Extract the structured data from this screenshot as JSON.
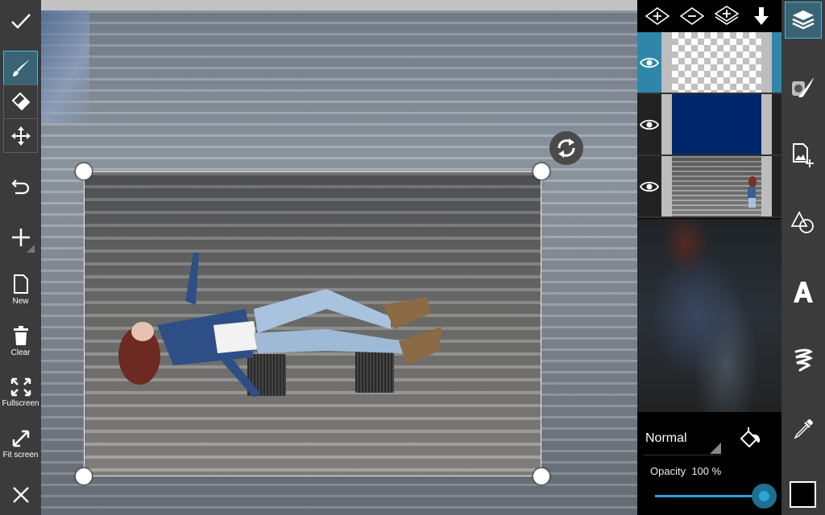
{
  "left_toolbar": {
    "confirm": "check-icon",
    "tools": [
      {
        "name": "brush",
        "active": true
      },
      {
        "name": "eraser",
        "active": false
      },
      {
        "name": "move",
        "active": false
      }
    ],
    "undo": "undo-icon",
    "add": "plus-icon",
    "new_label": "New",
    "clear_label": "Clear",
    "fullscreen_label": "Fullscreen",
    "fit_screen_label": "Fit screen",
    "close": "close-icon"
  },
  "layers": {
    "toolbar": [
      "add-layer",
      "remove-layer",
      "duplicate-layer",
      "merge-down"
    ],
    "items": [
      {
        "type": "transparent",
        "visible": true,
        "selected": true
      },
      {
        "type": "fill",
        "color": "#00276b",
        "visible": true,
        "selected": false
      },
      {
        "type": "photo",
        "visible": true,
        "selected": false
      }
    ]
  },
  "blend": {
    "mode": "Normal",
    "opacity_label": "Opacity",
    "opacity_value": "100 %",
    "opacity": 1.0
  },
  "right_toolbar": {
    "tools": [
      "layers",
      "photo-brush",
      "add-image",
      "shapes",
      "text",
      "effects",
      "eyedropper"
    ],
    "active": "layers",
    "current_color": "#000000"
  },
  "colors": {
    "accent": "#2ba4d6",
    "selected_layer": "#2e87aa",
    "toolbar_bg": "#3b3b3b"
  }
}
